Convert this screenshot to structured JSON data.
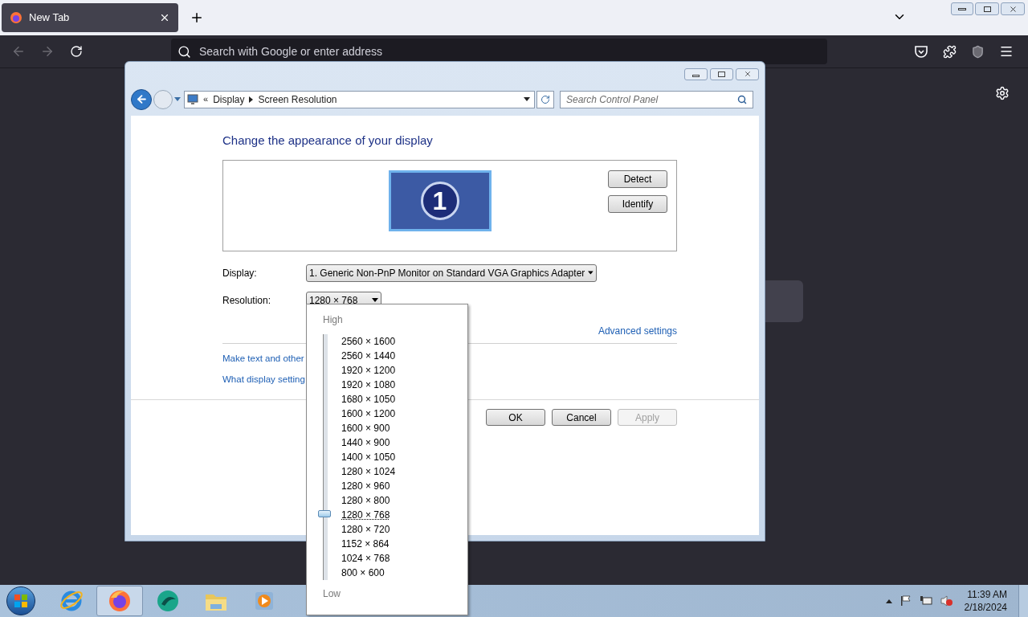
{
  "browser": {
    "tab": {
      "title": "New Tab",
      "selected": true
    },
    "address": {
      "placeholder": "Search with Google or enter address"
    }
  },
  "dialog": {
    "breadcrumb_overflow": "«",
    "breadcrumb": [
      "Display",
      "Screen Resolution"
    ],
    "search": {
      "placeholder": "Search Control Panel"
    },
    "heading": "Change the appearance of your display",
    "monitor_number": "1",
    "side_buttons": [
      "Detect",
      "Identify"
    ],
    "display": {
      "label": "Display:",
      "value": "1. Generic Non-PnP Monitor on Standard VGA Graphics Adapter"
    },
    "resolution": {
      "label": "Resolution:",
      "value": "1280 × 768"
    },
    "advanced_link": "Advanced settings",
    "links": [
      "Make text and other",
      "What display setting"
    ],
    "footer_buttons": [
      {
        "label": "OK",
        "disabled": false
      },
      {
        "label": "Cancel",
        "disabled": false
      },
      {
        "label": "Apply",
        "disabled": true
      }
    ]
  },
  "resolution_popup": {
    "high_label": "High",
    "low_label": "Low",
    "slider": {
      "level": 0.25
    },
    "options": [
      {
        "label": "2560 × 1600",
        "selected": false
      },
      {
        "label": "2560 × 1440",
        "selected": false
      },
      {
        "label": "1920 × 1200",
        "selected": false
      },
      {
        "label": "1920 × 1080",
        "selected": false
      },
      {
        "label": "1680 × 1050",
        "selected": false
      },
      {
        "label": "1600 × 1200",
        "selected": false
      },
      {
        "label": "1600 × 900",
        "selected": false
      },
      {
        "label": "1440 × 900",
        "selected": false
      },
      {
        "label": "1400 × 1050",
        "selected": false
      },
      {
        "label": "1280 × 1024",
        "selected": false
      },
      {
        "label": "1280 × 960",
        "selected": false
      },
      {
        "label": "1280 × 800",
        "selected": false
      },
      {
        "label": "1280 × 768",
        "selected": true
      },
      {
        "label": "1280 × 720",
        "selected": false
      },
      {
        "label": "1152 × 864",
        "selected": false
      },
      {
        "label": "1024 × 768",
        "selected": false
      },
      {
        "label": "800 × 600",
        "selected": false
      }
    ]
  },
  "taskbar": {
    "apps": [
      {
        "kind": "ie",
        "selected": false
      },
      {
        "kind": "firefox",
        "selected": true
      },
      {
        "kind": "swirl",
        "selected": false
      },
      {
        "kind": "folder",
        "selected": false
      },
      {
        "kind": "media",
        "selected": false
      }
    ],
    "clock": {
      "time": "11:39 AM",
      "date": "2/18/2024"
    }
  }
}
